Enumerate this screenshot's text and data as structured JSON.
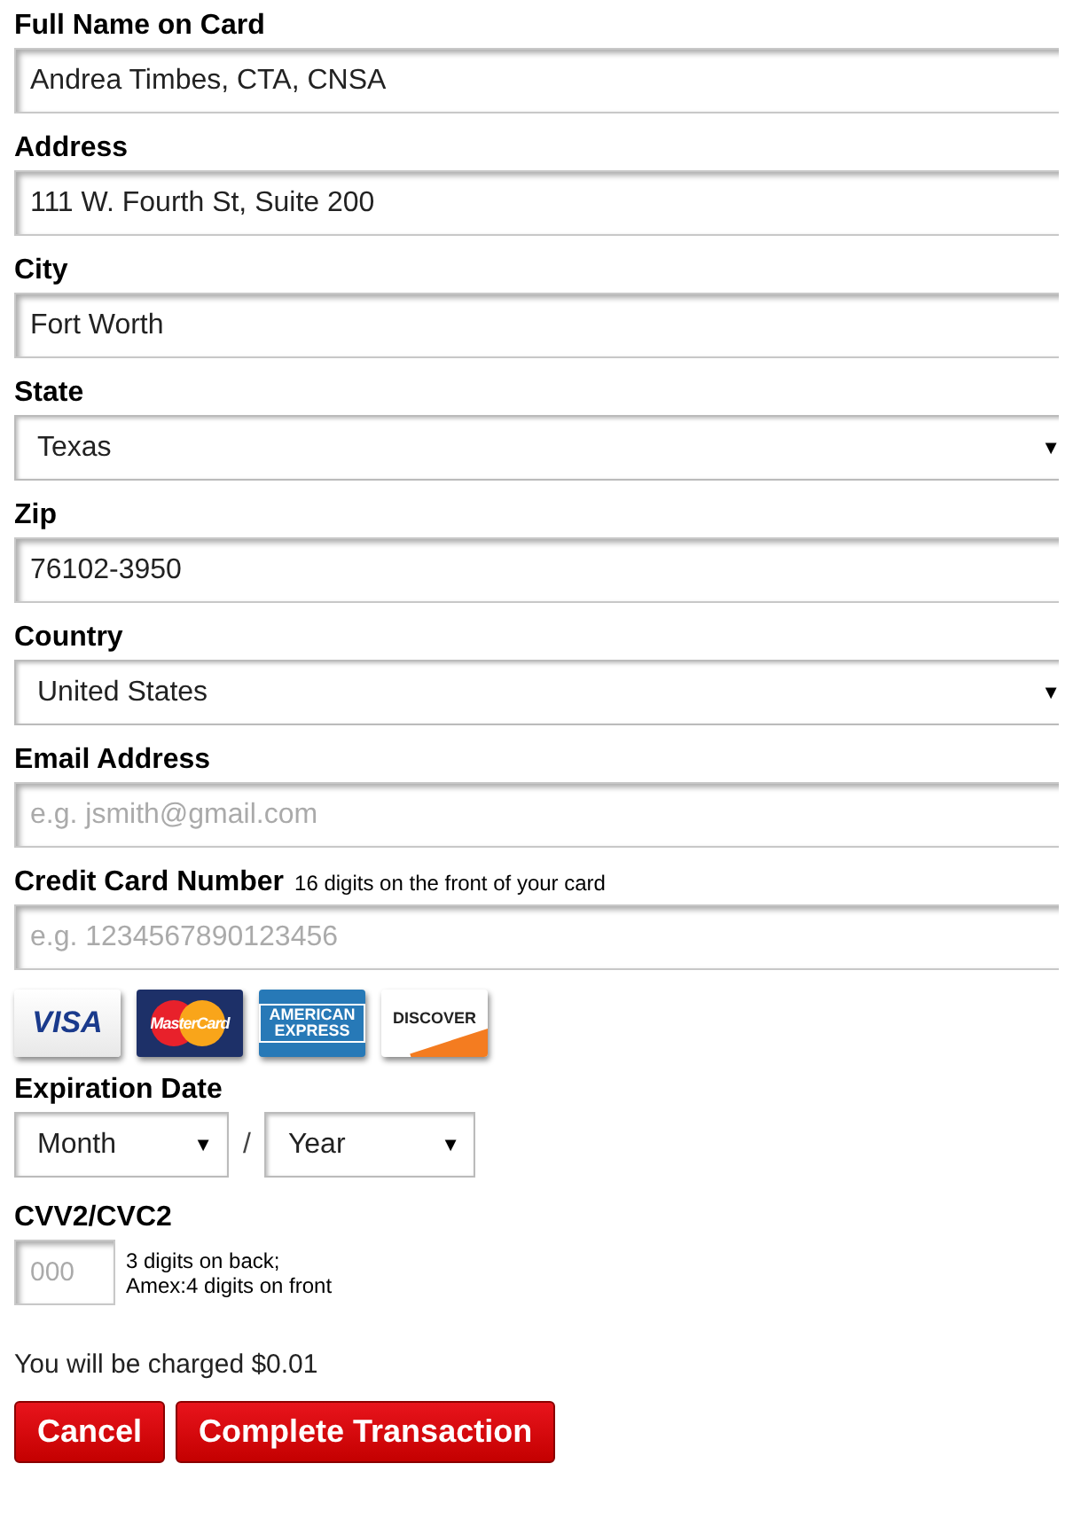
{
  "fields": [
    {
      "kind": "text",
      "label": "Full Name on Card",
      "value": "Andrea Timbes, CTA, CNSA"
    },
    {
      "kind": "text",
      "label": "Address",
      "value": "111 W. Fourth St, Suite 200"
    },
    {
      "kind": "text",
      "label": "City",
      "value": "Fort Worth"
    },
    {
      "kind": "select",
      "label": "State",
      "value": "Texas",
      "arrow": "▼"
    },
    {
      "kind": "text",
      "label": "Zip",
      "value": "76102-3950"
    },
    {
      "kind": "select",
      "label": "Country",
      "value": "United States",
      "arrow": "▼"
    },
    {
      "kind": "text",
      "label": "Email Address",
      "placeholder": "e.g. jsmith@gmail.com"
    },
    {
      "kind": "text",
      "label": "Credit Card Number",
      "hint": "16 digits on the front of your card",
      "placeholder": "e.g. 1234567890123456"
    }
  ],
  "cards": [
    {
      "kind": "visa",
      "label": "VISA"
    },
    {
      "kind": "mastercard",
      "label": "MasterCard"
    },
    {
      "kind": "amex",
      "label": "AMERICAN EXPRESS"
    },
    {
      "kind": "discover",
      "label": "DISCOVER"
    }
  ],
  "expiration": {
    "label": "Expiration Date",
    "month": "Month",
    "separator": "/",
    "year": "Year",
    "arrow": "▼"
  },
  "cvv": {
    "label": "CVV2/CVC2",
    "placeholder": "000",
    "hint_lines": [
      "3 digits on back;",
      "Amex:4 digits on front"
    ]
  },
  "charge_note": "You will be charged $0.01",
  "buttons": [
    "Cancel",
    "Complete Transaction"
  ]
}
